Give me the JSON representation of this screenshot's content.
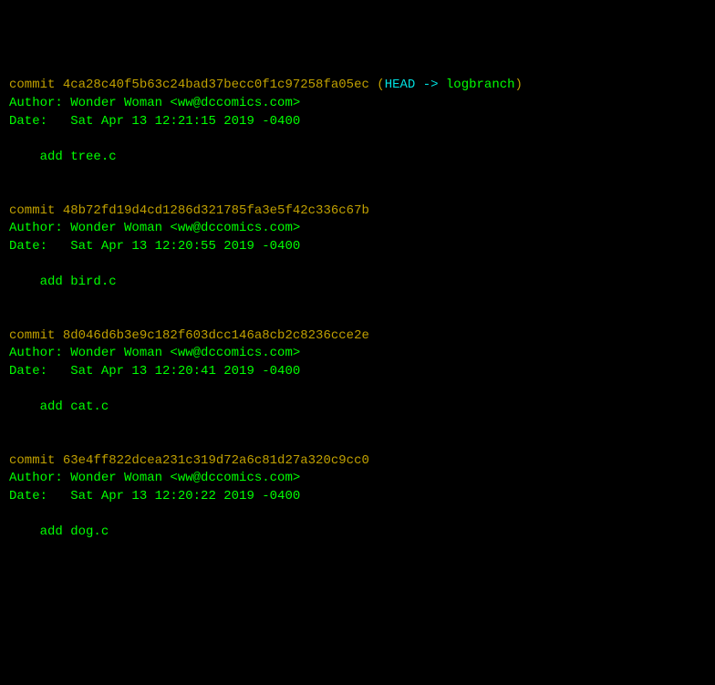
{
  "labels": {
    "commit_prefix": "commit ",
    "author_prefix": "Author: ",
    "date_prefix": "Date:   ",
    "head_open": "(",
    "head_label": "HEAD -> ",
    "head_close": ")"
  },
  "head_branch": "logbranch",
  "commits": [
    {
      "hash": "4ca28c40f5b63c24bad37becc0f1c97258fa05ec",
      "author": "Wonder Woman <ww@dccomics.com>",
      "date": "Sat Apr 13 12:21:15 2019 -0400",
      "message": "add tree.c",
      "is_head": true
    },
    {
      "hash": "48b72fd19d4cd1286d321785fa3e5f42c336c67b",
      "author": "Wonder Woman <ww@dccomics.com>",
      "date": "Sat Apr 13 12:20:55 2019 -0400",
      "message": "add bird.c",
      "is_head": false
    },
    {
      "hash": "8d046d6b3e9c182f603dcc146a8cb2c8236cce2e",
      "author": "Wonder Woman <ww@dccomics.com>",
      "date": "Sat Apr 13 12:20:41 2019 -0400",
      "message": "add cat.c",
      "is_head": false
    },
    {
      "hash": "63e4ff822dcea231c319d72a6c81d27a320c9cc0",
      "author": "Wonder Woman <ww@dccomics.com>",
      "date": "Sat Apr 13 12:20:22 2019 -0400",
      "message": "add dog.c",
      "is_head": false
    }
  ]
}
